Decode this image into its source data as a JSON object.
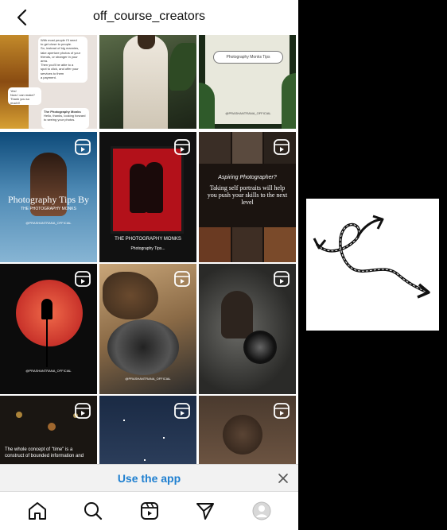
{
  "header": {
    "title": "off_course_creators",
    "back_icon": "chevron-left-icon"
  },
  "grid": {
    "tiles": [
      {
        "id": "t1",
        "kind": "chat-post",
        "lines": [
          "With most people I'll need",
          "to get close to people.",
          "So, instead of big mannies,",
          "take aperture photos of your",
          "friends, or stranger in your",
          "area.",
          "Then you'll be able to a",
          "spot to click, and offer your",
          "services to them",
          "a payment."
        ],
        "bubble1": "Yes!",
        "bubble2": "Now I can make? Thank you so much!!",
        "bubble3": "The Photography Monks",
        "bubble3_sub": "Hello, thanks, looking forward to seeing your photos."
      },
      {
        "id": "t2",
        "kind": "portrait-plants"
      },
      {
        "id": "t3",
        "kind": "search-card",
        "search_text": "Photography Monks Tips",
        "footer": "@PRASHANTRANA_OFFICIAL"
      },
      {
        "id": "t4",
        "kind": "reel",
        "caption": "Photography Tips By",
        "subcaption": "THE PHOTOGRAPHY MONKS",
        "handle": "@PRASHANTRANA_OFFICIAL"
      },
      {
        "id": "t5",
        "kind": "reel",
        "caption": "THE PHOTOGRAPHY MONKS",
        "subcaption": "Photography Tips..."
      },
      {
        "id": "t6",
        "kind": "reel",
        "caption": "Aspiring Photographer?",
        "subcaption": "Taking self portraits will help you push your skills to the next level"
      },
      {
        "id": "t7",
        "kind": "reel",
        "handle": "@PRASHANTRANA_OFFICIAL"
      },
      {
        "id": "t8",
        "kind": "reel",
        "handle": "@PRASHANTRANA_OFFICIAL"
      },
      {
        "id": "t9",
        "kind": "reel"
      },
      {
        "id": "t10",
        "kind": "reel",
        "caption": "The whole concept of \"time\" is a construct of bounded information and"
      },
      {
        "id": "t11",
        "kind": "reel"
      },
      {
        "id": "t12",
        "kind": "reel"
      }
    ],
    "reel_icon": "reels-icon"
  },
  "banner": {
    "link_label": "Use the app",
    "close_icon": "close-icon"
  },
  "tabbar": {
    "tabs": [
      {
        "name": "home-icon"
      },
      {
        "name": "search-icon"
      },
      {
        "name": "reels-icon"
      },
      {
        "name": "direct-message-icon"
      },
      {
        "name": "profile-avatar-icon"
      }
    ]
  },
  "side_panel": {
    "icon": "curly-arrow-icon"
  },
  "colors": {
    "link": "#1e7fd0",
    "border": "#dbdbdb",
    "banner_bg": "#f2f2f2"
  }
}
